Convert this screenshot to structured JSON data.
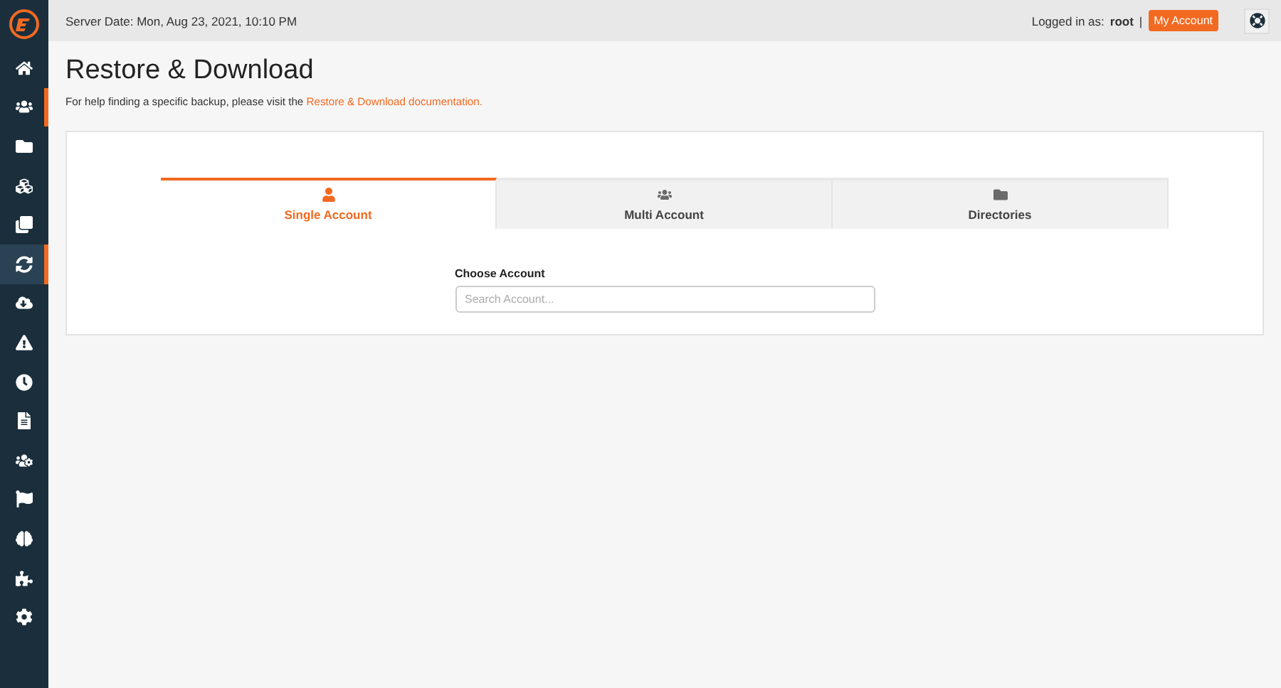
{
  "topbar": {
    "server_date": "Server Date: Mon, Aug 23, 2021, 10:10 PM",
    "logged_in_label": "Logged in as:",
    "user": "root",
    "separator": "|",
    "account_button": "My Account"
  },
  "sidebar": {
    "items": [
      {
        "kind": "home",
        "selected": false,
        "accent": false
      },
      {
        "kind": "users",
        "selected": false,
        "accent": true
      },
      {
        "kind": "folder",
        "selected": false,
        "accent": false
      },
      {
        "kind": "cubes",
        "selected": false,
        "accent": false
      },
      {
        "kind": "copy",
        "selected": false,
        "accent": false
      },
      {
        "kind": "sync",
        "selected": true,
        "accent": true
      },
      {
        "kind": "cloud",
        "selected": false,
        "accent": false
      },
      {
        "kind": "warning",
        "selected": false,
        "accent": false
      },
      {
        "kind": "clock",
        "selected": false,
        "accent": false
      },
      {
        "kind": "file",
        "selected": false,
        "accent": false
      },
      {
        "kind": "users-cog",
        "selected": false,
        "accent": false
      },
      {
        "kind": "flag",
        "selected": false,
        "accent": false
      },
      {
        "kind": "brain",
        "selected": false,
        "accent": false
      },
      {
        "kind": "puzzle",
        "selected": false,
        "accent": false
      },
      {
        "kind": "gear",
        "selected": false,
        "accent": false
      }
    ]
  },
  "page": {
    "title": "Restore & Download",
    "help_text": "For help finding a specific backup, please visit the",
    "help_link": "Restore & Download documentation."
  },
  "tabs": [
    {
      "label": "Single Account",
      "kind": "user",
      "selected": true
    },
    {
      "label": "Multi Account",
      "kind": "users",
      "selected": false
    },
    {
      "label": "Directories",
      "kind": "folder",
      "selected": false
    }
  ],
  "account_field": {
    "label": "Choose Account",
    "placeholder": "Search Account..."
  }
}
